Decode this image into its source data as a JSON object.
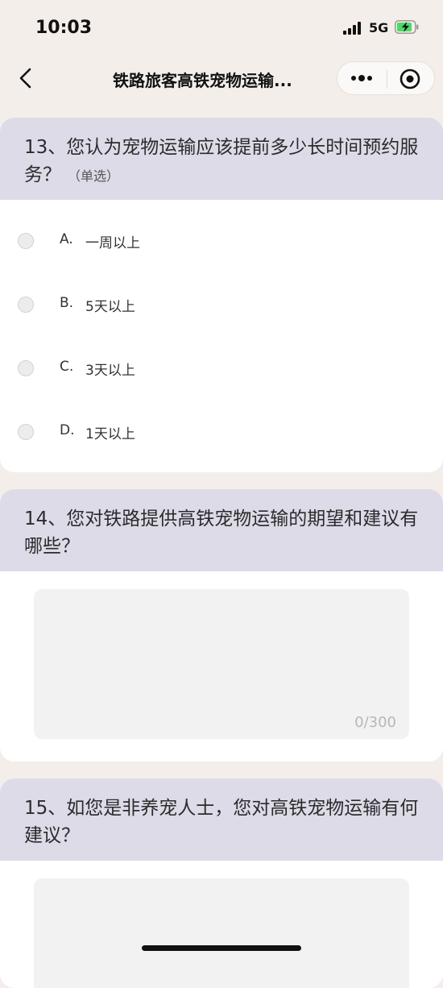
{
  "status_bar": {
    "time": "10:03",
    "network": "5G"
  },
  "nav": {
    "title": "铁路旅客高铁宠物运输..."
  },
  "questions": [
    {
      "title": "13、您认为宠物运输应该提前多少长时间预约服务？",
      "tag": "（单选）",
      "options": [
        {
          "letter": "A.",
          "text": "一周以上"
        },
        {
          "letter": "B.",
          "text": "5天以上"
        },
        {
          "letter": "C.",
          "text": "3天以上"
        },
        {
          "letter": "D.",
          "text": "1天以上"
        }
      ]
    },
    {
      "title": "14、您对铁路提供高铁宠物运输的期望和建议有哪些？",
      "counter": "0/300"
    },
    {
      "title": "15、如您是非养宠人士，您对高铁宠物运输有何建议？"
    }
  ]
}
